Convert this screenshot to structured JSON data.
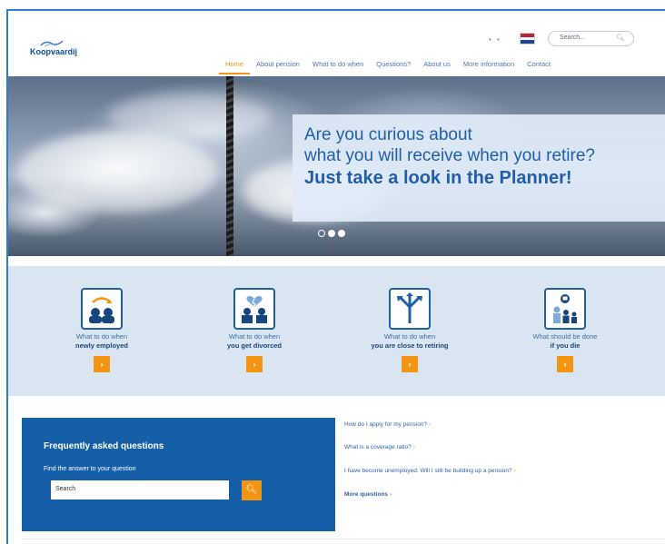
{
  "brand": {
    "name": "Koopvaardij"
  },
  "header": {
    "lang_dots": "• •",
    "search_placeholder": "Search...",
    "search_icon": "magnifier-icon"
  },
  "nav": [
    {
      "label": "Home",
      "active": true
    },
    {
      "label": "About pension"
    },
    {
      "label": "What to do when"
    },
    {
      "label": "Questions?"
    },
    {
      "label": "About us"
    },
    {
      "label": "More information"
    },
    {
      "label": "Contact"
    }
  ],
  "hero": {
    "line1": "Are you curious about",
    "line2": "what you will receive when you retire?",
    "line3": "Just take a look in the Planner!"
  },
  "events": [
    {
      "line1": "What to do when",
      "line2": "newly employed",
      "icon": "people-arrow-icon"
    },
    {
      "line1": "What to do when",
      "line2": "you get divorced",
      "icon": "broken-heart-icon"
    },
    {
      "line1": "What to do when",
      "line2": "you are close to retiring",
      "icon": "signpost-icon"
    },
    {
      "line1": "What should be done",
      "line2": "if you die",
      "icon": "family-loss-icon"
    }
  ],
  "faq": {
    "title": "Frequently asked questions",
    "subtitle": "Find the answer to your question",
    "search_placeholder": "Search",
    "questions": [
      "How do I apply for my pension?",
      "What is a coverage ratio?",
      "I have become unemployed. Will I still be building up a pension?"
    ],
    "more": "More questions"
  },
  "colors": {
    "accent": "#f39412",
    "brand_blue": "#155ea8",
    "light_band": "#d9e6f2"
  }
}
